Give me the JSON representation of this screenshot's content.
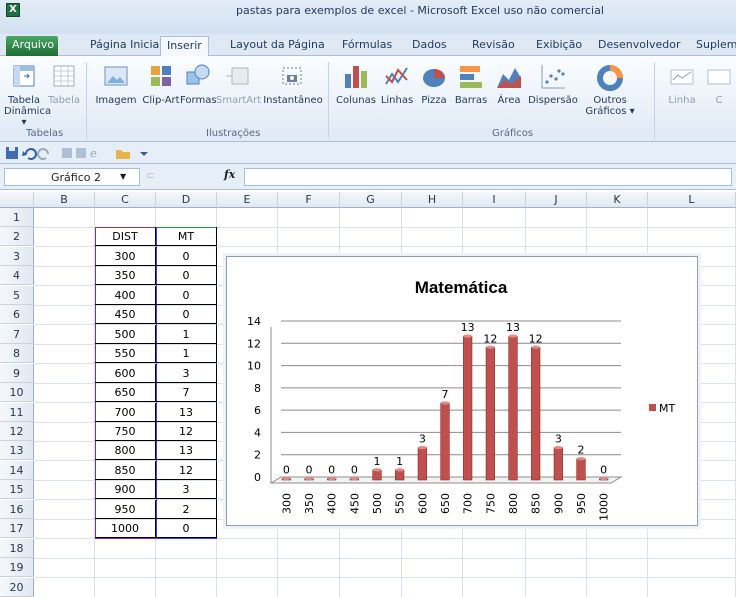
{
  "window": {
    "app_icon": "X",
    "title": "pastas para exemplos de excel - Microsoft Excel uso não comercial"
  },
  "tabs": [
    "Arquivo",
    "Página Inicial",
    "Inserir",
    "Layout da Página",
    "Fórmulas",
    "Dados",
    "Revisão",
    "Exibição",
    "Desenvolvedor",
    "Suplem"
  ],
  "active_tab": "Inserir",
  "ribbon": {
    "groups": [
      {
        "label": "Tabelas",
        "buttons": [
          "Tabela Dinâmica ▾",
          "Tabela"
        ]
      },
      {
        "label": "Ilustrações",
        "buttons": [
          "Imagem",
          "Clip-Art",
          "Formas",
          "SmartArt",
          "Instantâneo"
        ]
      },
      {
        "label": "Gráficos",
        "buttons": [
          "Colunas",
          "Linhas",
          "Pizza",
          "Barras",
          "Área",
          "Dispersão",
          "Outros Gráficos ▾"
        ]
      },
      {
        "label": "",
        "buttons": [
          "Linha",
          "C"
        ]
      }
    ]
  },
  "name_box": "Gráfico 2",
  "fx_label": "fx",
  "columns": [
    "B",
    "C",
    "D",
    "E",
    "F",
    "G",
    "H",
    "I",
    "J",
    "K",
    "L"
  ],
  "rows": [
    "1",
    "2",
    "3",
    "4",
    "5",
    "6",
    "7",
    "8",
    "9",
    "10",
    "11",
    "12",
    "13",
    "14",
    "15",
    "16",
    "17",
    "18",
    "19",
    "20"
  ],
  "table": {
    "headers": [
      "DIST",
      "MT"
    ],
    "rows": [
      [
        "300",
        "0"
      ],
      [
        "350",
        "0"
      ],
      [
        "400",
        "0"
      ],
      [
        "450",
        "0"
      ],
      [
        "500",
        "1"
      ],
      [
        "550",
        "1"
      ],
      [
        "600",
        "3"
      ],
      [
        "650",
        "7"
      ],
      [
        "700",
        "13"
      ],
      [
        "750",
        "12"
      ],
      [
        "800",
        "13"
      ],
      [
        "850",
        "12"
      ],
      [
        "900",
        "3"
      ],
      [
        "950",
        "2"
      ],
      [
        "1000",
        "0"
      ]
    ]
  },
  "chart_data": {
    "type": "bar",
    "title": "Matemática",
    "categories": [
      "300",
      "350",
      "400",
      "450",
      "500",
      "550",
      "600",
      "650",
      "700",
      "750",
      "800",
      "850",
      "900",
      "950",
      "1000"
    ],
    "series": [
      {
        "name": "MT",
        "values": [
          0,
          0,
          0,
          0,
          1,
          1,
          3,
          7,
          13,
          12,
          13,
          12,
          3,
          2,
          0
        ],
        "color": "#c0504d"
      }
    ],
    "ylim": [
      0,
      14
    ],
    "yticks": [
      0,
      2,
      4,
      6,
      8,
      10,
      12,
      14
    ],
    "grid": true,
    "legend": "right",
    "data_labels": true
  }
}
